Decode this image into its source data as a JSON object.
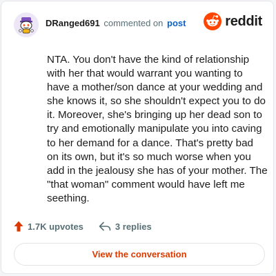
{
  "header": {
    "username": "DRanged691",
    "verb": "commented on",
    "post_link": "post",
    "brand_name": "reddit"
  },
  "comment": {
    "text": "NTA. You don't have the kind of relationship with her that would warrant you wanting to have a mother/son dance at your wedding and she knows it, so she shouldn't expect you to do it. Moreover, she's bringing up her dead son to try and emotionally manipulate you into caving to her demand for a dance. That's pretty bad on its own, but it's so much worse when you add in the jealousy she has of your mother. The \"that woman\" comment would have left me seething."
  },
  "actions": {
    "upvotes_label": "1.7K upvotes",
    "replies_label": "3 replies",
    "upvote_icon": "upvote-arrow-icon",
    "reply_icon": "reply-arrow-icon"
  },
  "footer": {
    "view_button_label": "View the conversation"
  },
  "colors": {
    "brand_orange": "#ff4500",
    "upvote_orange": "#d93a00",
    "link_blue": "#0b62c7",
    "muted_text": "#576f76",
    "avatar_bg": "#ece6f7"
  },
  "icons": {
    "avatar": "snoo-avatar-icon",
    "brand_logo": "reddit-logo-icon"
  }
}
